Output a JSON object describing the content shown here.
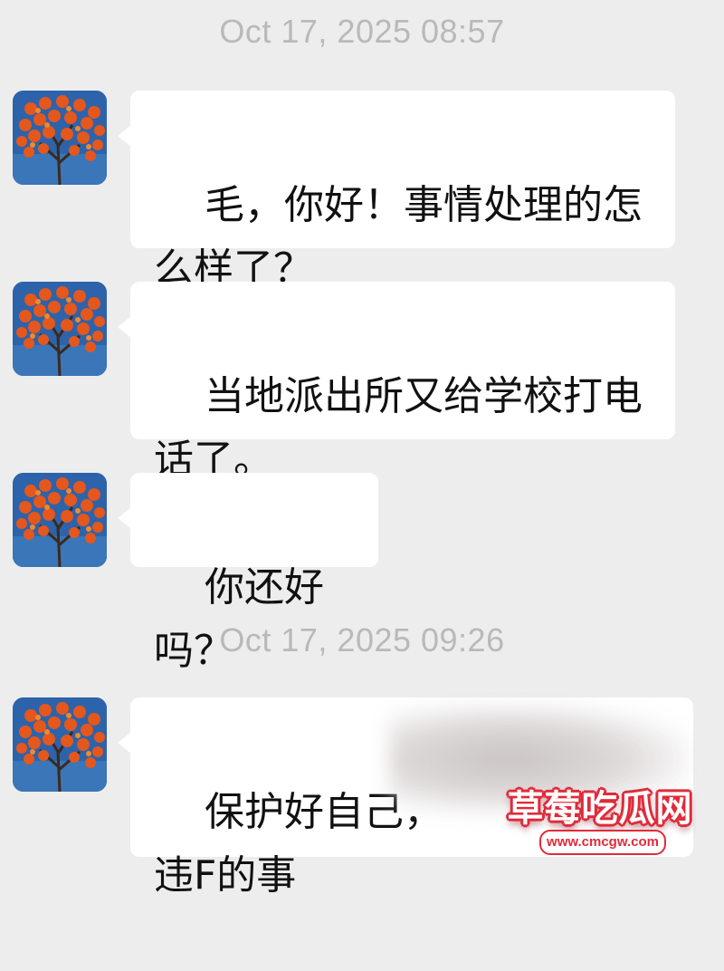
{
  "colors": {
    "background": "#ededed",
    "bubble": "#ffffff",
    "timestamp_text": "#b9b9b9",
    "message_text": "#111111",
    "watermark_red": "#e02b3a"
  },
  "chat": {
    "timestamps": [
      "Oct 17, 2025 08:57",
      "Oct 17, 2025 09:26"
    ],
    "messages": [
      {
        "avatar_icon": "persimmon-tree-avatar-icon",
        "text": "毛，你好！事情处理的怎\n么样了？"
      },
      {
        "avatar_icon": "persimmon-tree-avatar-icon",
        "text": "当地派出所又给学校打电\n话了。"
      },
      {
        "avatar_icon": "persimmon-tree-avatar-icon",
        "text": "你还好吗？"
      },
      {
        "avatar_icon": "persimmon-tree-avatar-icon",
        "text": "保护好自己，\n违F的事"
      }
    ]
  },
  "watermark": {
    "title": "草莓吃瓜网",
    "url": "www.cmcgw.com"
  }
}
